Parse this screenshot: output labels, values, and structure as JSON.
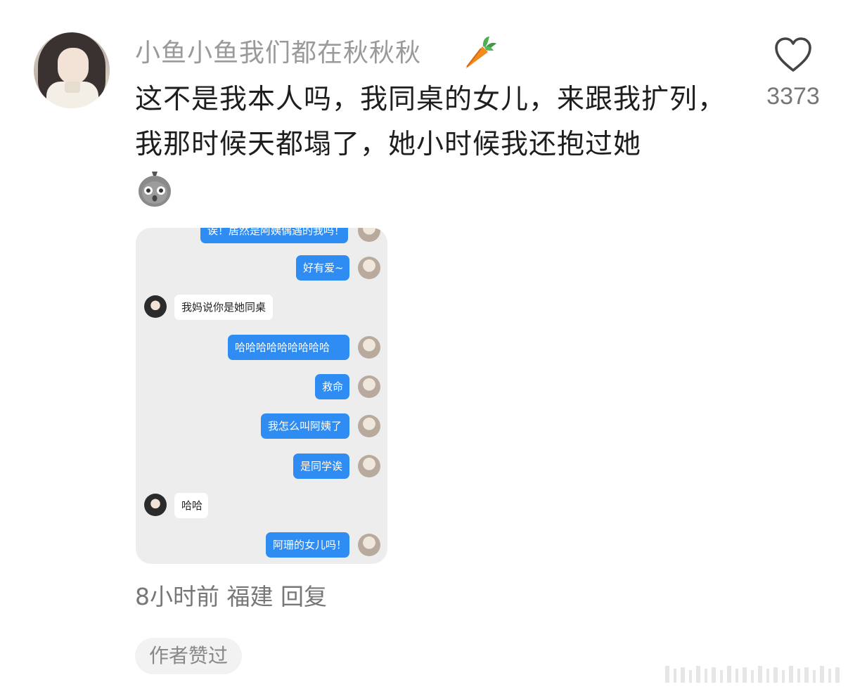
{
  "user": {
    "name": "小鱼小鱼我们都在秋秋秋"
  },
  "like": {
    "count": "3373"
  },
  "comment": {
    "text": "这不是我本人吗，我同桌的女儿，来跟我扩列，我那时候天都塌了，她小时候我还抱过她"
  },
  "chat_screenshot": {
    "messages": [
      {
        "side": "me",
        "text": "诶！居然是阿姨偶遇的我吗！"
      },
      {
        "side": "me",
        "text": "好有爱~"
      },
      {
        "side": "them",
        "text": "我妈说你是她同桌"
      },
      {
        "side": "me",
        "text": "哈哈哈哈哈哈哈哈哈"
      },
      {
        "side": "me",
        "text": "救命"
      },
      {
        "side": "me",
        "text": "我怎么叫阿姨了"
      },
      {
        "side": "me",
        "text": "是同学诶"
      },
      {
        "side": "them",
        "text": "哈哈"
      },
      {
        "side": "me",
        "text": "阿珊的女儿吗！"
      }
    ]
  },
  "footer": {
    "time": "8小时前",
    "location": "福建",
    "reply_label": "回复",
    "author_liked": "作者赞过"
  },
  "icons": [
    "heart-icon",
    "carrot-emoji",
    "chick-emoji"
  ],
  "colors": {
    "bubble_me": "#2f8cf2",
    "bubble_them": "#ffffff",
    "chat_bg": "#ededed",
    "username": "#9a9a9a"
  }
}
